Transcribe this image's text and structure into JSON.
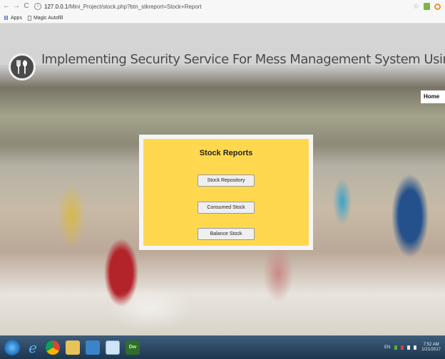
{
  "browser": {
    "nav": {
      "back": "←",
      "forward": "→",
      "reload": "C"
    },
    "url": {
      "host": "127.0.0.1",
      "path": "/Mini_Project/stock.php?btn_stkreport=Stock+Report"
    },
    "star": "☆",
    "bookmarks": [
      {
        "label": "Apps"
      },
      {
        "label": "Magic Autofill"
      }
    ]
  },
  "site": {
    "title": "Implementing Security Service For Mess Management System Using PHP.",
    "nav_home": "Home"
  },
  "report": {
    "title": "Stock Reports",
    "buttons": [
      {
        "label": "Stock Repository"
      },
      {
        "label": "Consumed Stock"
      },
      {
        "label": "Balance Stock"
      }
    ]
  },
  "taskbar": {
    "tray_lang": "EN",
    "clock": {
      "time": "7:52 AM",
      "date": "1/21/2017"
    }
  },
  "colors": {
    "report_box": "#ffd84f",
    "report_border": "#f5f5f5",
    "title_text": "#4a4a4a",
    "taskbar": "#2a4562"
  },
  "icons": [
    "back-arrow-icon",
    "forward-arrow-icon",
    "reload-icon",
    "info-icon",
    "star-icon",
    "apps-icon",
    "page-icon",
    "fork-spoon-icon",
    "start-icon",
    "ie-icon",
    "chrome-icon",
    "folder-icon",
    "media-player-icon",
    "window-icon",
    "dreamweaver-icon"
  ]
}
